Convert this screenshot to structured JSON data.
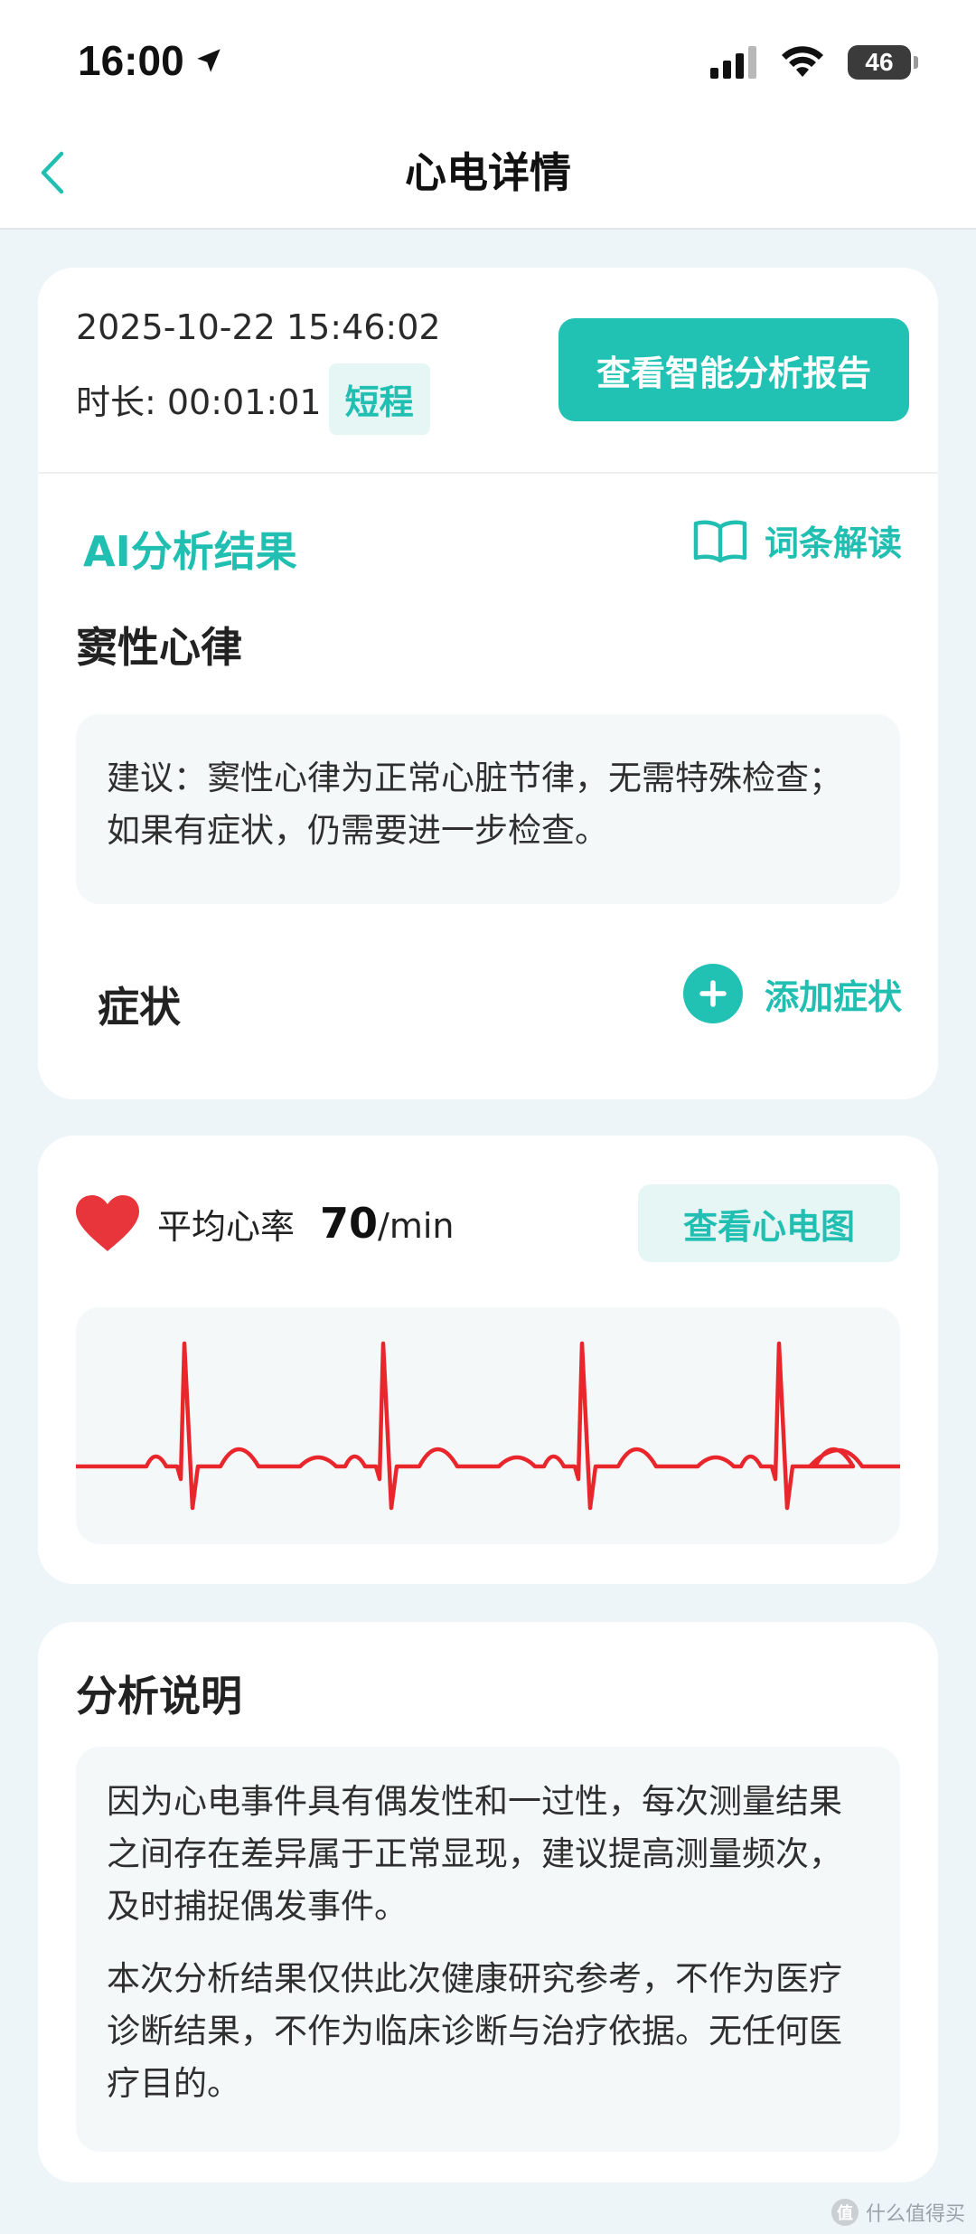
{
  "status_bar": {
    "time": "16:00",
    "battery": "46"
  },
  "nav": {
    "title": "心电详情"
  },
  "record": {
    "datetime": "2025-10-22 15:46:02",
    "duration_label": "时长: 00:01:01",
    "duration_tag": "短程",
    "report_button": "查看智能分析报告"
  },
  "ai_result": {
    "title": "AI分析结果",
    "glossary_link": "词条解读",
    "rhythm": "窦性心律",
    "advice": "建议：窦性心律为正常心脏节律，无需特殊检查；如果有症状，仍需要进一步检查。"
  },
  "symptoms": {
    "label": "症状",
    "add_button": "添加症状"
  },
  "heart_rate": {
    "label": "平均心率",
    "value": "70",
    "unit": "/min",
    "view_ecg_button": "查看心电图"
  },
  "analysis_note": {
    "title": "分析说明",
    "paragraph1": "因为心电事件具有偶发性和一过性，每次测量结果之间存在差异属于正常显现，建议提高测量频次，及时捕捉偶发事件。",
    "paragraph2": "本次分析结果仅供此次健康研究参考，不作为医疗诊断结果，不作为临床诊断与治疗依据。无任何医疗目的。"
  },
  "watermark": {
    "text": "什么值得买",
    "badge": "值"
  },
  "colors": {
    "accent": "#21c2b3",
    "accent_text": "#20bfb1",
    "tag_bg": "#e6f6f5",
    "heart": "#e8353b",
    "ecg_line": "#e8262c",
    "page_bg": "#eef5f8"
  }
}
